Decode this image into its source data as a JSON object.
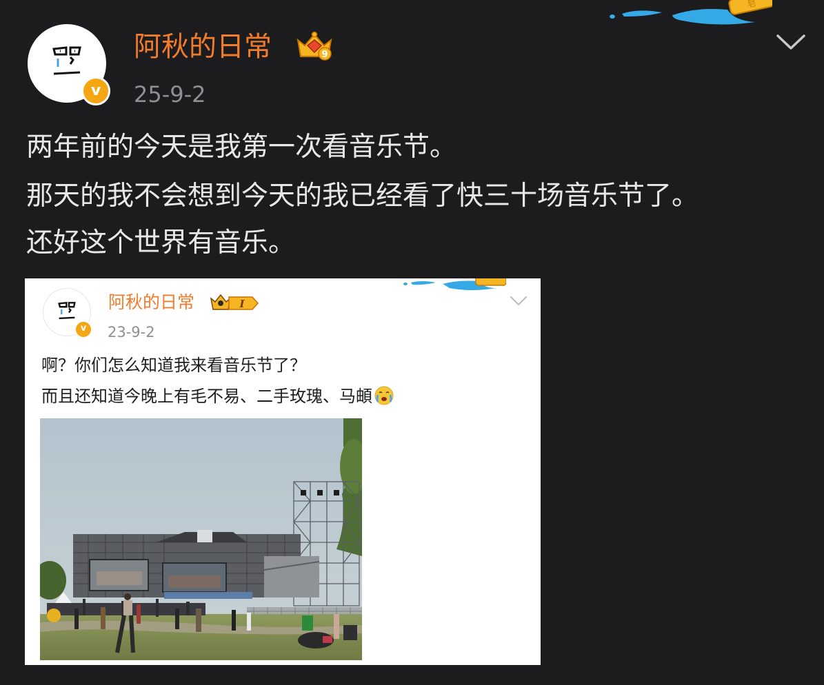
{
  "post": {
    "author": "阿秋的日常",
    "date": "25-9-2",
    "lines": [
      "两年前的今天是我第一次看音乐节。",
      "那天的我不会想到今天的我已经看了快三十场音乐节了。",
      "还好这个世界有音乐。"
    ],
    "badge_icon": "verified-v-badge",
    "crown_level": "9"
  },
  "repost": {
    "author": "阿秋的日常",
    "date": "23-9-2",
    "line1": "啊？你们怎么知道我来看音乐节了？",
    "line2": "而且还知道今晚上有毛不易、二手玫瑰、马頔",
    "crown_level": "I",
    "emoji": "crying-face-emoji",
    "photo": "music-festival-stage-photo"
  },
  "colors": {
    "background": "#1c1c1e",
    "username": "#f07c2c",
    "date": "#8e8e93",
    "body_text": "#e8e8e8",
    "verified_badge": "#f4a712"
  }
}
